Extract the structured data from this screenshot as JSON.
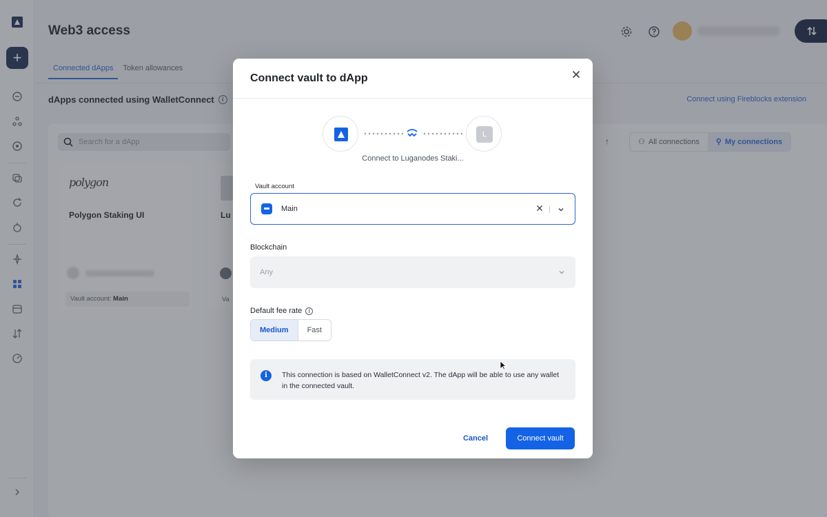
{
  "app": {
    "page_title": "Web3 access",
    "tabs": [
      {
        "label": "Connected dApps",
        "active": true
      },
      {
        "label": "Token allowances",
        "active": false
      }
    ],
    "section_title": "dApps connected using WalletConnect",
    "extension_link": "Connect using Fireblocks extension",
    "search": {
      "placeholder": "Search for a dApp"
    },
    "connection_filter": [
      {
        "label": "All connections",
        "active": false
      },
      {
        "label": "My connections",
        "active": true
      }
    ],
    "cards": [
      {
        "logo_text": "polygon",
        "name": "Polygon Staking UI",
        "vault_label": "Vault account:",
        "vault_value": "Main"
      },
      {
        "name": "Lu",
        "vault_label": "Va"
      }
    ]
  },
  "modal": {
    "title": "Connect vault to dApp",
    "connect_caption": "Connect to Luganodes Staki...",
    "dapp_initial": "L",
    "vault_account": {
      "label": "Vault account",
      "value": "Main"
    },
    "blockchain": {
      "label": "Blockchain",
      "placeholder": "Any"
    },
    "fee_rate": {
      "label": "Default fee rate",
      "options": [
        {
          "label": "Medium",
          "active": true
        },
        {
          "label": "Fast",
          "active": false
        }
      ]
    },
    "info_text": "This connection is based on WalletConnect v2. The dApp will be able to use any wallet in the connected vault.",
    "cancel_label": "Cancel",
    "connect_label": "Connect vault"
  },
  "colors": {
    "primary": "#1463e6",
    "link": "#2a64d6",
    "sidebar_dark": "#1b2b52"
  },
  "icons": [
    "fireblocks-logo-icon",
    "walletconnect-icon",
    "close-icon",
    "chevron-down-icon",
    "info-icon",
    "vault-icon",
    "search-icon",
    "gear-icon",
    "help-icon",
    "transfer-icon"
  ]
}
